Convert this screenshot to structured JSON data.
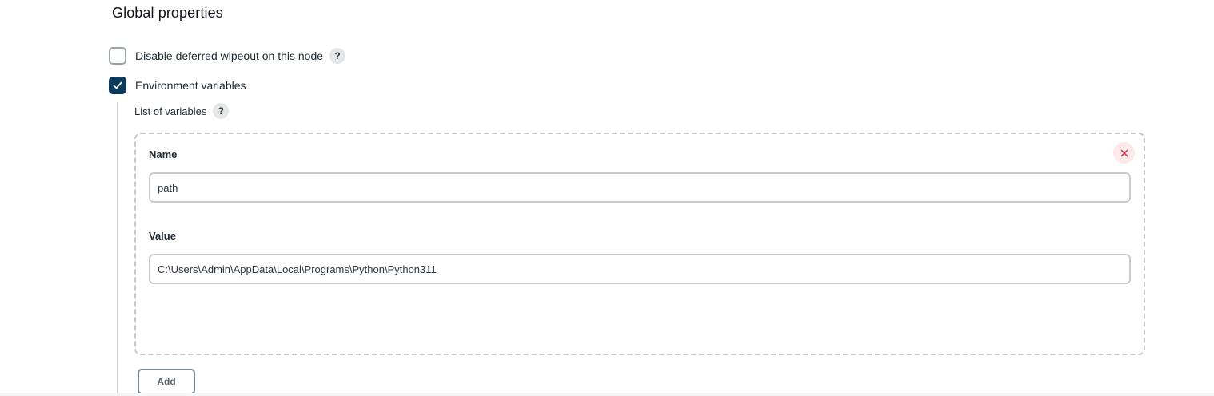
{
  "section": {
    "title": "Global properties"
  },
  "options": {
    "disable_wipeout": {
      "label": "Disable deferred wipeout on this node",
      "checked": false,
      "help": "?"
    },
    "env_vars": {
      "label": "Environment variables",
      "checked": true
    }
  },
  "env_list": {
    "label": "List of variables",
    "help": "?",
    "delete_icon": "close-icon",
    "entries": [
      {
        "name_label": "Name",
        "name_value": "path",
        "value_label": "Value",
        "value_value": "C:\\Users\\Admin\\AppData\\Local\\Programs\\Python\\Python311"
      }
    ],
    "add_label": "Add"
  },
  "colors": {
    "checkbox_checked": "#0b3a5a",
    "delete_icon": "#d2283a",
    "delete_bg": "#fde8ea"
  }
}
